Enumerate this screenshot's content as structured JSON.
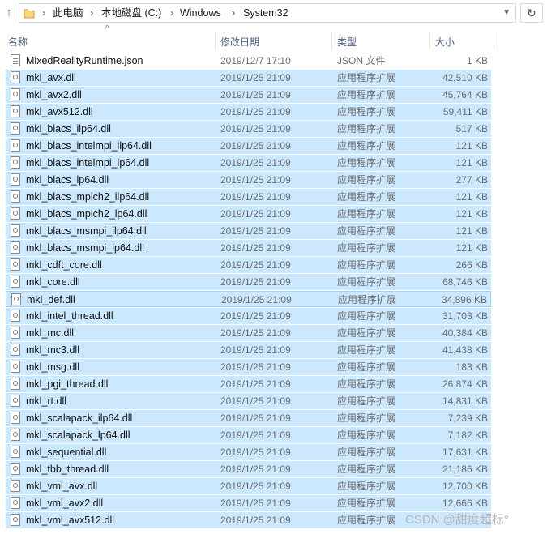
{
  "address_bar": {
    "crumbs": [
      "此电脑",
      "本地磁盘 (C:)",
      "Windows",
      "System32"
    ],
    "separator": "›"
  },
  "columns": {
    "name": "名称",
    "date": "修改日期",
    "type": "类型",
    "size": "大小"
  },
  "files": [
    {
      "name": "MixedRealityRuntime.json",
      "date": "2019/12/7 17:10",
      "type": "JSON 文件",
      "size": "1 KB",
      "icon": "json-file-icon",
      "selected": false
    },
    {
      "name": "mkl_avx.dll",
      "date": "2019/1/25 21:09",
      "type": "应用程序扩展",
      "size": "42,510 KB",
      "icon": "dll-file-icon",
      "selected": true
    },
    {
      "name": "mkl_avx2.dll",
      "date": "2019/1/25 21:09",
      "type": "应用程序扩展",
      "size": "45,764 KB",
      "icon": "dll-file-icon",
      "selected": true
    },
    {
      "name": "mkl_avx512.dll",
      "date": "2019/1/25 21:09",
      "type": "应用程序扩展",
      "size": "59,411 KB",
      "icon": "dll-file-icon",
      "selected": true
    },
    {
      "name": "mkl_blacs_ilp64.dll",
      "date": "2019/1/25 21:09",
      "type": "应用程序扩展",
      "size": "517 KB",
      "icon": "dll-file-icon",
      "selected": true
    },
    {
      "name": "mkl_blacs_intelmpi_ilp64.dll",
      "date": "2019/1/25 21:09",
      "type": "应用程序扩展",
      "size": "121 KB",
      "icon": "dll-file-icon",
      "selected": true
    },
    {
      "name": "mkl_blacs_intelmpi_lp64.dll",
      "date": "2019/1/25 21:09",
      "type": "应用程序扩展",
      "size": "121 KB",
      "icon": "dll-file-icon",
      "selected": true
    },
    {
      "name": "mkl_blacs_lp64.dll",
      "date": "2019/1/25 21:09",
      "type": "应用程序扩展",
      "size": "277 KB",
      "icon": "dll-file-icon",
      "selected": true
    },
    {
      "name": "mkl_blacs_mpich2_ilp64.dll",
      "date": "2019/1/25 21:09",
      "type": "应用程序扩展",
      "size": "121 KB",
      "icon": "dll-file-icon",
      "selected": true
    },
    {
      "name": "mkl_blacs_mpich2_lp64.dll",
      "date": "2019/1/25 21:09",
      "type": "应用程序扩展",
      "size": "121 KB",
      "icon": "dll-file-icon",
      "selected": true
    },
    {
      "name": "mkl_blacs_msmpi_ilp64.dll",
      "date": "2019/1/25 21:09",
      "type": "应用程序扩展",
      "size": "121 KB",
      "icon": "dll-file-icon",
      "selected": true
    },
    {
      "name": "mkl_blacs_msmpi_lp64.dll",
      "date": "2019/1/25 21:09",
      "type": "应用程序扩展",
      "size": "121 KB",
      "icon": "dll-file-icon",
      "selected": true
    },
    {
      "name": "mkl_cdft_core.dll",
      "date": "2019/1/25 21:09",
      "type": "应用程序扩展",
      "size": "266 KB",
      "icon": "dll-file-icon",
      "selected": true
    },
    {
      "name": "mkl_core.dll",
      "date": "2019/1/25 21:09",
      "type": "应用程序扩展",
      "size": "68,746 KB",
      "icon": "dll-file-icon",
      "selected": true
    },
    {
      "name": "mkl_def.dll",
      "date": "2019/1/25 21:09",
      "type": "应用程序扩展",
      "size": "34,896 KB",
      "icon": "dll-file-icon",
      "selected": true,
      "focused": true
    },
    {
      "name": "mkl_intel_thread.dll",
      "date": "2019/1/25 21:09",
      "type": "应用程序扩展",
      "size": "31,703 KB",
      "icon": "dll-file-icon",
      "selected": true
    },
    {
      "name": "mkl_mc.dll",
      "date": "2019/1/25 21:09",
      "type": "应用程序扩展",
      "size": "40,384 KB",
      "icon": "dll-file-icon",
      "selected": true
    },
    {
      "name": "mkl_mc3.dll",
      "date": "2019/1/25 21:09",
      "type": "应用程序扩展",
      "size": "41,438 KB",
      "icon": "dll-file-icon",
      "selected": true
    },
    {
      "name": "mkl_msg.dll",
      "date": "2019/1/25 21:09",
      "type": "应用程序扩展",
      "size": "183 KB",
      "icon": "dll-file-icon",
      "selected": true
    },
    {
      "name": "mkl_pgi_thread.dll",
      "date": "2019/1/25 21:09",
      "type": "应用程序扩展",
      "size": "26,874 KB",
      "icon": "dll-file-icon",
      "selected": true
    },
    {
      "name": "mkl_rt.dll",
      "date": "2019/1/25 21:09",
      "type": "应用程序扩展",
      "size": "14,831 KB",
      "icon": "dll-file-icon",
      "selected": true
    },
    {
      "name": "mkl_scalapack_ilp64.dll",
      "date": "2019/1/25 21:09",
      "type": "应用程序扩展",
      "size": "7,239 KB",
      "icon": "dll-file-icon",
      "selected": true
    },
    {
      "name": "mkl_scalapack_lp64.dll",
      "date": "2019/1/25 21:09",
      "type": "应用程序扩展",
      "size": "7,182 KB",
      "icon": "dll-file-icon",
      "selected": true
    },
    {
      "name": "mkl_sequential.dll",
      "date": "2019/1/25 21:09",
      "type": "应用程序扩展",
      "size": "17,631 KB",
      "icon": "dll-file-icon",
      "selected": true
    },
    {
      "name": "mkl_tbb_thread.dll",
      "date": "2019/1/25 21:09",
      "type": "应用程序扩展",
      "size": "21,186 KB",
      "icon": "dll-file-icon",
      "selected": true
    },
    {
      "name": "mkl_vml_avx.dll",
      "date": "2019/1/25 21:09",
      "type": "应用程序扩展",
      "size": "12,700 KB",
      "icon": "dll-file-icon",
      "selected": true
    },
    {
      "name": "mkl_vml_avx2.dll",
      "date": "2019/1/25 21:09",
      "type": "应用程序扩展",
      "size": "12,666 KB",
      "icon": "dll-file-icon",
      "selected": true
    },
    {
      "name": "mkl_vml_avx512.dll",
      "date": "2019/1/25 21:09",
      "type": "应用程序扩展",
      "size": "",
      "icon": "dll-file-icon",
      "selected": true
    }
  ],
  "watermark": "CSDN @甜度超标°",
  "colors": {
    "selection_bg": "#cce8ff",
    "focus_border": "#99d1ff",
    "header_text": "#4d6082",
    "secondary_text": "#6d6d6d"
  }
}
